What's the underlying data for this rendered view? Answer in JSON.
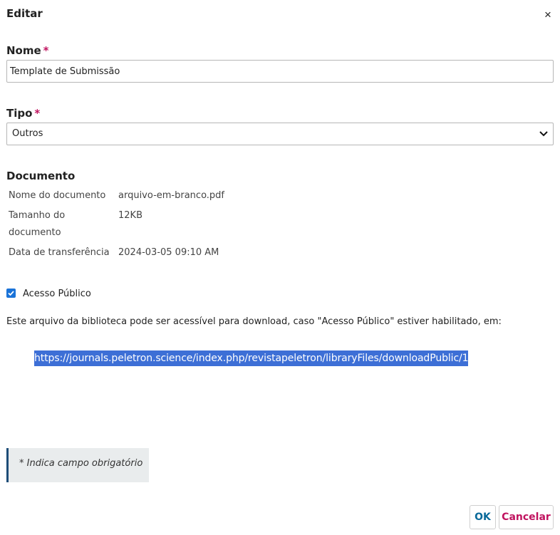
{
  "dialog": {
    "title": "Editar",
    "close_icon": "×"
  },
  "form": {
    "name": {
      "label": "Nome",
      "required_mark": "*",
      "value": "Template de Submissão"
    },
    "type": {
      "label": "Tipo",
      "required_mark": "*",
      "selected": "Outros"
    }
  },
  "document": {
    "heading": "Documento",
    "rows": [
      {
        "key": "Nome do documento",
        "value": "arquivo-em-branco.pdf"
      },
      {
        "key": "Tamanho do documento",
        "value": "12KB"
      },
      {
        "key": "Data de transferência",
        "value": "2024-03-05 09:10 AM"
      }
    ]
  },
  "public_access": {
    "checked": true,
    "label": "Acesso Público",
    "description": "Este arquivo da biblioteca pode ser acessível para download, caso \"Acesso Público\" estiver habilitado, em:",
    "url": "https://journals.peletron.science/index.php/revistapeletron/libraryFiles/downloadPublic/1"
  },
  "notice": {
    "text": "* Indica campo obrigatório"
  },
  "buttons": {
    "ok": "OK",
    "cancel": "Cancelar"
  },
  "colors": {
    "required": "#c0135f",
    "checkbox": "#1a73d8",
    "selection": "#3d6fd6",
    "notice_border": "#1d4d78",
    "ok_text": "#0a6a9a",
    "cancel_text": "#c0135f"
  }
}
